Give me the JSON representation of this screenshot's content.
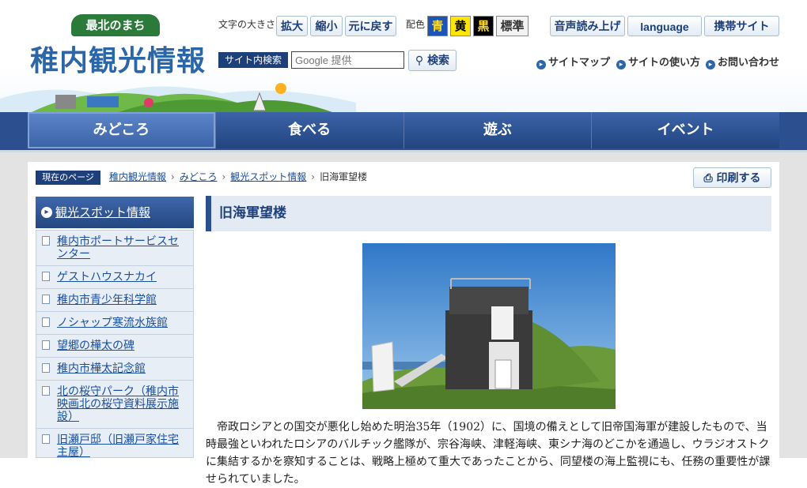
{
  "header": {
    "logo_tagline": "最北のまち",
    "logo_title": "稚内観光情報",
    "font_size_label": "文字の大きさ",
    "font_buttons": [
      "拡大",
      "縮小",
      "元に戻す"
    ],
    "color_label": "配色",
    "color_buttons": [
      {
        "label": "青",
        "bg": "#1c55b5",
        "fg": "#ffdc2e"
      },
      {
        "label": "黄",
        "bg": "#ffe600",
        "fg": "#000000"
      },
      {
        "label": "黒",
        "bg": "#000000",
        "fg": "#ffdc2e"
      },
      {
        "label": "標準",
        "bg": "#f2f2f2",
        "fg": "#333333"
      }
    ],
    "search_label": "サイト内検索",
    "search_placeholder": "Google 提供",
    "search_button": "検索",
    "top_buttons": [
      "音声読み上げ",
      "language",
      "携帯サイト"
    ],
    "util_links": [
      "サイトマップ",
      "サイトの使い方",
      "お問い合わせ"
    ]
  },
  "nav": {
    "items": [
      "みどころ",
      "食べる",
      "遊ぶ",
      "イベント"
    ],
    "active_index": 0
  },
  "breadcrumb": {
    "label": "現在のページ",
    "links": [
      "稚内観光情報",
      "みどころ",
      "観光スポット情報"
    ],
    "current": "旧海軍望楼"
  },
  "print_button": "印刷する",
  "sidebar": {
    "heading": "観光スポット情報",
    "items": [
      "稚内市ポートサービスセンター",
      "ゲストハウスナカイ",
      "稚内市青少年科学館",
      "ノシャップ寒流水族館",
      "望郷の樺太の碑",
      "稚内市樺太記念館",
      "北の桜守パーク（稚内市映画北の桜守資料展示施設）",
      "旧瀬戸邸（旧瀬戸家住宅主屋）"
    ]
  },
  "main": {
    "title": "旧海軍望楼",
    "body": "帝政ロシアとの国交が悪化し始めた明治35年（1902）に、国境の備えとして旧帝国海軍が建設したもので、当時最強といわれたロシアのバルチック艦隊が、宗谷海峡、津軽海峡、東シナ海のどこかを通過し、ウラジオストクに集結するかを察知することは、戦略上極めて重大であったことから、同望楼の海上監視にも、任務の重要性が課せられていました。"
  }
}
